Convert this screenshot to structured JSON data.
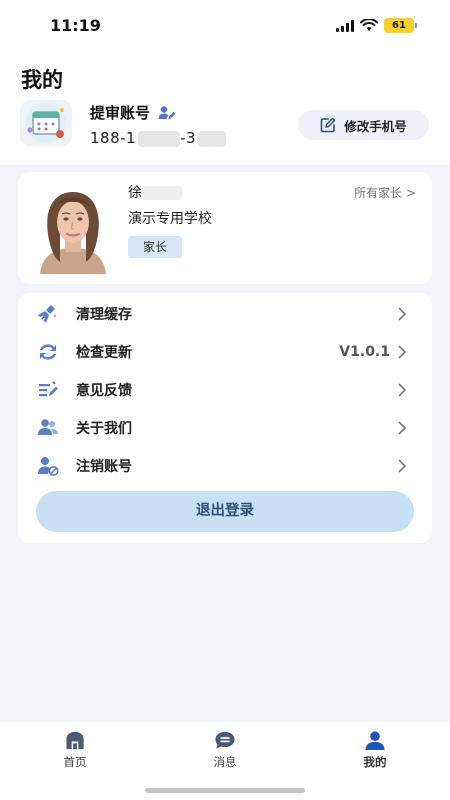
{
  "status_bar": {
    "time": "11:19",
    "battery": "61"
  },
  "header": {
    "title": "我的",
    "account_name": "提审账号",
    "account_phone": "188-1",
    "account_phone_tail": "-3",
    "edit_phone_label": "修改手机号"
  },
  "profile": {
    "name_initial": "徐",
    "school": "演示专用学校",
    "role": "家长",
    "all_parents": "所有家长 >"
  },
  "menu": {
    "items": [
      {
        "label": "清理缓存",
        "value": "",
        "icon": "broom-icon"
      },
      {
        "label": "检查更新",
        "value": "V1.0.1",
        "icon": "refresh-icon"
      },
      {
        "label": "意见反馈",
        "value": "",
        "icon": "feedback-icon"
      },
      {
        "label": "关于我们",
        "value": "",
        "icon": "about-users-icon"
      },
      {
        "label": "注销账号",
        "value": "",
        "icon": "deactivate-user-icon"
      }
    ],
    "logout_label": "退出登录"
  },
  "tabbar": {
    "tabs": [
      {
        "label": "首页",
        "icon": "home-icon"
      },
      {
        "label": "消息",
        "icon": "message-icon"
      },
      {
        "label": "我的",
        "icon": "user-icon"
      }
    ],
    "active": "我的"
  },
  "colors": {
    "accent": "#4f78c4",
    "icon_blue": "#5a7fc7",
    "logout_bg": "#c8e0f5",
    "badge_bg": "#d6e6f7",
    "page_bg": "#f1f4f9"
  }
}
